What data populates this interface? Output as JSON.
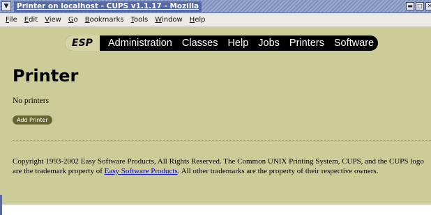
{
  "window": {
    "title": "Printer on localhost - CUPS v1.1.17 - Mozilla",
    "sysmenu_icon": "chevron-down-icon",
    "buttons": [
      "minimize",
      "maximize",
      "close"
    ]
  },
  "menubar": {
    "items": [
      {
        "mnemonic": "F",
        "rest": "ile"
      },
      {
        "mnemonic": "E",
        "rest": "dit"
      },
      {
        "mnemonic": "V",
        "rest": "iew"
      },
      {
        "mnemonic": "G",
        "rest": "o"
      },
      {
        "mnemonic": "B",
        "rest": "ookmarks"
      },
      {
        "mnemonic": "T",
        "rest": "ools"
      },
      {
        "mnemonic": "W",
        "rest": "indow"
      },
      {
        "mnemonic": "H",
        "rest": "elp"
      }
    ]
  },
  "nav": {
    "logo": "ESP",
    "links": [
      "Administration",
      "Classes",
      "Help",
      "Jobs",
      "Printers",
      "Software"
    ]
  },
  "page": {
    "title": "Printer",
    "status": "No printers",
    "add_button": "Add Printer"
  },
  "footer": {
    "text_before": "Copyright 1993-2002 Easy Software Products, All Rights Reserved. The Common UNIX Printing System, CUPS, and the CUPS logo are the trademark property of ",
    "link": "Easy Software Products",
    "text_after": ". All other trademarks are the property of their respective owners."
  },
  "colors": {
    "page_bg": "#cccc99",
    "nav_bg": "#000000",
    "logo_bg": "#d4d4a6",
    "button_bg": "#666633",
    "link": "#0000cc",
    "titlebar": "#7f90bb"
  }
}
